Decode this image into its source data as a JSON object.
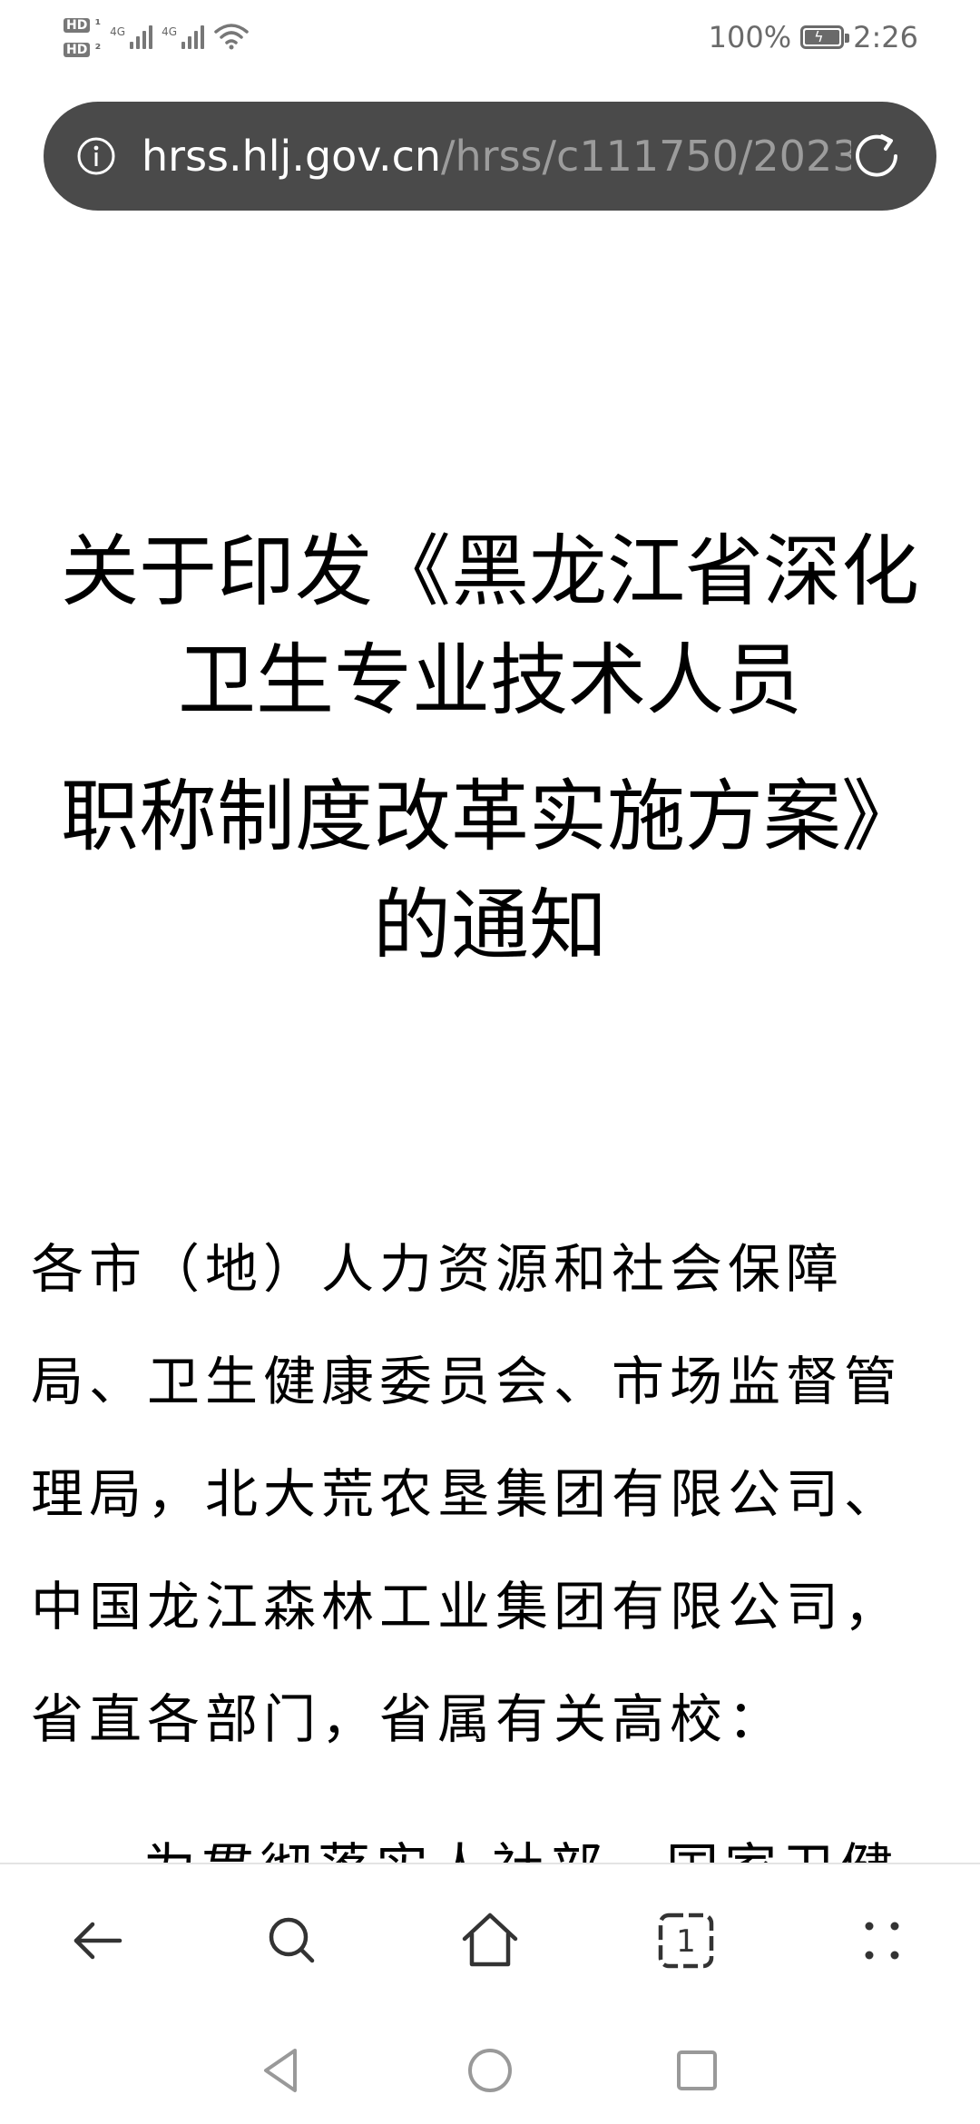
{
  "status_bar": {
    "sim1_label": "HD",
    "sim2_label": "HD",
    "network_1": "4G",
    "network_2": "4G",
    "battery_percent": "100%",
    "time": "2:26"
  },
  "url_bar": {
    "host": "hrss.hlj.gov.cn",
    "path": "/hrss/c111750/2023"
  },
  "article": {
    "title_lines": [
      "关于印发《黑龙江省深化",
      "卫生专业技术人员",
      "职称制度改革实施方案》",
      "的通知"
    ],
    "body_lines": [
      "各市（地）人力资源和社会保障",
      "局、卫生健康委员会、市场监督管",
      "理局，北大荒农垦集团有限公司、",
      "中国龙江森林工业集团有限公司，",
      "省直各部门，省属有关高校："
    ],
    "partial_line": "为贯彻落实人社部、国家卫健"
  },
  "toolbar": {
    "tab_count": "1"
  },
  "colors": {
    "url_bar_bg": "#4a4a4a",
    "url_host": "#ffffff",
    "url_path": "#9c9c9c",
    "icon_gray": "#333333"
  }
}
